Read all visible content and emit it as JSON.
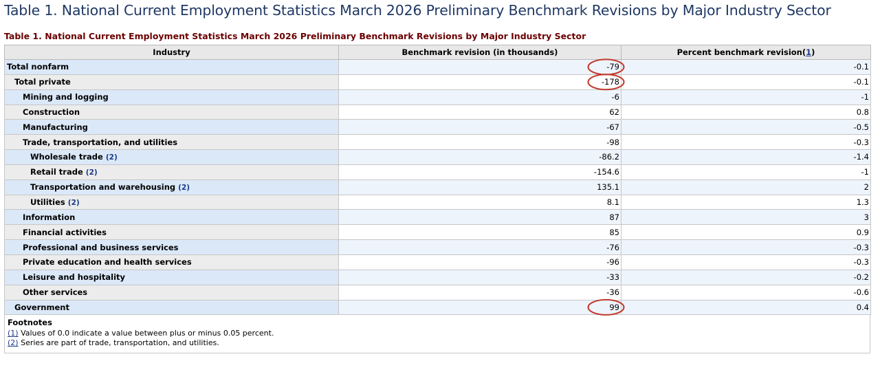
{
  "page_title": "Table 1. National Current Employment Statistics March 2026 Preliminary Benchmark Revisions by Major Industry Sector",
  "table_caption": "Table 1. National Current Employment Statistics March 2026 Preliminary Benchmark Revisions by Major Industry Sector",
  "columns": {
    "industry": "Industry",
    "revision": "Benchmark revision (in thousands)",
    "percent": "Percent benchmark revision",
    "percent_ref": "1"
  },
  "rows": [
    {
      "industry": "Total nonfarm",
      "level": 0,
      "ref": "",
      "revision": "-79",
      "percent": "-0.1",
      "circled": true
    },
    {
      "industry": "Total private",
      "level": 1,
      "ref": "",
      "revision": "-178",
      "percent": "-0.1",
      "circled": true
    },
    {
      "industry": "Mining and logging",
      "level": 2,
      "ref": "",
      "revision": "-6",
      "percent": "-1",
      "circled": false
    },
    {
      "industry": "Construction",
      "level": 2,
      "ref": "",
      "revision": "62",
      "percent": "0.8",
      "circled": false
    },
    {
      "industry": "Manufacturing",
      "level": 2,
      "ref": "",
      "revision": "-67",
      "percent": "-0.5",
      "circled": false
    },
    {
      "industry": "Trade, transportation, and utilities",
      "level": 2,
      "ref": "",
      "revision": "-98",
      "percent": "-0.3",
      "circled": false
    },
    {
      "industry": "Wholesale trade",
      "level": 3,
      "ref": "(2)",
      "revision": "-86.2",
      "percent": "-1.4",
      "circled": false
    },
    {
      "industry": "Retail trade",
      "level": 3,
      "ref": "(2)",
      "revision": "-154.6",
      "percent": "-1",
      "circled": false
    },
    {
      "industry": "Transportation and warehousing",
      "level": 3,
      "ref": "(2)",
      "revision": "135.1",
      "percent": "2",
      "circled": false
    },
    {
      "industry": "Utilities",
      "level": 3,
      "ref": "(2)",
      "revision": "8.1",
      "percent": "1.3",
      "circled": false
    },
    {
      "industry": "Information",
      "level": 2,
      "ref": "",
      "revision": "87",
      "percent": "3",
      "circled": false
    },
    {
      "industry": "Financial activities",
      "level": 2,
      "ref": "",
      "revision": "85",
      "percent": "0.9",
      "circled": false
    },
    {
      "industry": "Professional and business services",
      "level": 2,
      "ref": "",
      "revision": "-76",
      "percent": "-0.3",
      "circled": false
    },
    {
      "industry": "Private education and health services",
      "level": 2,
      "ref": "",
      "revision": "-96",
      "percent": "-0.3",
      "circled": false
    },
    {
      "industry": "Leisure and hospitality",
      "level": 2,
      "ref": "",
      "revision": "-33",
      "percent": "-0.2",
      "circled": false
    },
    {
      "industry": "Other services",
      "level": 2,
      "ref": "",
      "revision": "-36",
      "percent": "-0.6",
      "circled": false
    },
    {
      "industry": "Government",
      "level": 1,
      "ref": "",
      "revision": "99",
      "percent": "0.4",
      "circled": true
    }
  ],
  "footnotes": {
    "title": "Footnotes",
    "items": [
      {
        "ref": "(1)",
        "text": "Values of 0.0 indicate a value between plus or minus 0.05 percent."
      },
      {
        "ref": "(2)",
        "text": "Series are part of trade, transportation, and utilities."
      }
    ]
  },
  "colors": {
    "page_title": "#1f3864",
    "caption": "#6b0000",
    "annotation_circle": "#c0392b",
    "link": "#1a3a8a"
  }
}
